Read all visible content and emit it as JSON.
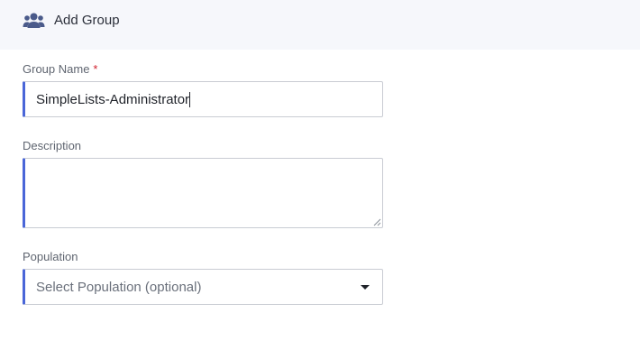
{
  "header": {
    "icon": "users-group-icon",
    "title": "Add Group"
  },
  "form": {
    "group_name": {
      "label": "Group Name",
      "required_marker": "*",
      "value": "SimpleLists-Administrator"
    },
    "description": {
      "label": "Description",
      "value": ""
    },
    "population": {
      "label": "Population",
      "placeholder": "Select Population (optional)",
      "icon": "caret-down-icon"
    }
  },
  "colors": {
    "accent": "#4a66d8",
    "required": "#d0212e",
    "header_bg": "#f6f7fb",
    "icon": "#4a5a8a"
  }
}
